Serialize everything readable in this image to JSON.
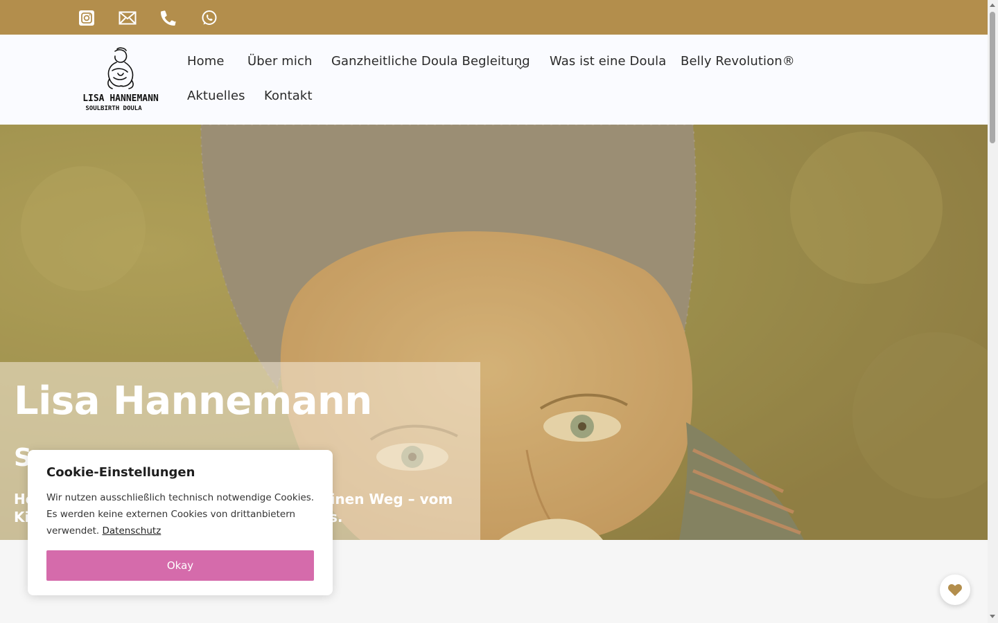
{
  "topbar": {
    "icons": [
      "instagram-icon",
      "mail-icon",
      "phone-icon",
      "whatsapp-icon"
    ],
    "background": "#b38e4c"
  },
  "logo": {
    "name": "LISA HANNEMANN",
    "subtitle": "SOULBIRTH DOULA"
  },
  "nav": {
    "items": [
      "Home",
      "Über mich",
      "Ganzheitliche Doula Begleitung",
      "Was ist eine Doula",
      "Belly Revolution®",
      "Aktuelles",
      "Kontakt"
    ]
  },
  "hero": {
    "title": "Lisa Hannemann",
    "subtitle": "S",
    "tagline_start": "He",
    "tagline_mid": "einen Weg – vom",
    "tagline_line2_start": "Ki",
    "tagline_line2_end": "s."
  },
  "cookie": {
    "title": "Cookie-Einstellungen",
    "text": "Wir nutzen ausschließlich technisch notwendige Cookies. Es werden keine externen Cookies von drittanbietern verwendet.",
    "link": "Datenschutz",
    "button": "Okay"
  },
  "colors": {
    "accent": "#b38e4c",
    "button": "#d56bab"
  }
}
